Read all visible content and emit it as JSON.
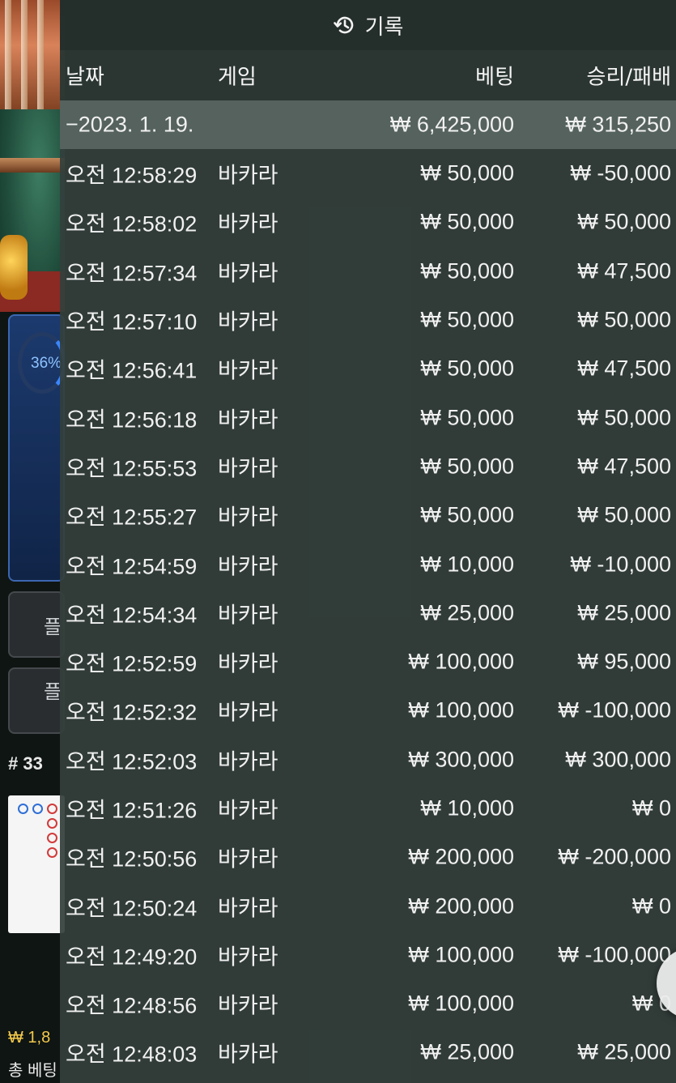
{
  "background": {
    "timer_text": "36%",
    "button1_text": "플",
    "button2_text": "플",
    "shoe_label": "# 33",
    "balance_text": "₩ 1,8",
    "total_bet_text": "총 베팅"
  },
  "panel": {
    "title": "기록",
    "icon": "history-icon",
    "columns": {
      "date": "날짜",
      "game": "게임",
      "bet": "베팅",
      "win_loss": "승리/패배"
    },
    "summary": {
      "date": "−2023. 1. 19.",
      "game": "",
      "bet": "₩ 6,425,000",
      "win_loss": "₩ 315,250"
    },
    "rows": [
      {
        "time": "오전 12:58:29",
        "game": "바카라",
        "bet": "₩ 50,000",
        "win_loss": "₩ -50,000"
      },
      {
        "time": "오전 12:58:02",
        "game": "바카라",
        "bet": "₩ 50,000",
        "win_loss": "₩ 50,000"
      },
      {
        "time": "오전 12:57:34",
        "game": "바카라",
        "bet": "₩ 50,000",
        "win_loss": "₩ 47,500"
      },
      {
        "time": "오전 12:57:10",
        "game": "바카라",
        "bet": "₩ 50,000",
        "win_loss": "₩ 50,000"
      },
      {
        "time": "오전 12:56:41",
        "game": "바카라",
        "bet": "₩ 50,000",
        "win_loss": "₩ 47,500"
      },
      {
        "time": "오전 12:56:18",
        "game": "바카라",
        "bet": "₩ 50,000",
        "win_loss": "₩ 50,000"
      },
      {
        "time": "오전 12:55:53",
        "game": "바카라",
        "bet": "₩ 50,000",
        "win_loss": "₩ 47,500"
      },
      {
        "time": "오전 12:55:27",
        "game": "바카라",
        "bet": "₩ 50,000",
        "win_loss": "₩ 50,000"
      },
      {
        "time": "오전 12:54:59",
        "game": "바카라",
        "bet": "₩ 10,000",
        "win_loss": "₩ -10,000"
      },
      {
        "time": "오전 12:54:34",
        "game": "바카라",
        "bet": "₩ 25,000",
        "win_loss": "₩ 25,000"
      },
      {
        "time": "오전 12:52:59",
        "game": "바카라",
        "bet": "₩ 100,000",
        "win_loss": "₩ 95,000"
      },
      {
        "time": "오전 12:52:32",
        "game": "바카라",
        "bet": "₩ 100,000",
        "win_loss": "₩ -100,000"
      },
      {
        "time": "오전 12:52:03",
        "game": "바카라",
        "bet": "₩ 300,000",
        "win_loss": "₩ 300,000"
      },
      {
        "time": "오전 12:51:26",
        "game": "바카라",
        "bet": "₩ 10,000",
        "win_loss": "₩ 0"
      },
      {
        "time": "오전 12:50:56",
        "game": "바카라",
        "bet": "₩ 200,000",
        "win_loss": "₩ -200,000"
      },
      {
        "time": "오전 12:50:24",
        "game": "바카라",
        "bet": "₩ 200,000",
        "win_loss": "₩ 0"
      },
      {
        "time": "오전 12:49:20",
        "game": "바카라",
        "bet": "₩ 100,000",
        "win_loss": "₩ -100,000"
      },
      {
        "time": "오전 12:48:56",
        "game": "바카라",
        "bet": "₩ 100,000",
        "win_loss": "₩ 0"
      },
      {
        "time": "오전 12:48:03",
        "game": "바카라",
        "bet": "₩ 25,000",
        "win_loss": "₩ 25,000"
      }
    ],
    "close_icon": "close-icon"
  }
}
